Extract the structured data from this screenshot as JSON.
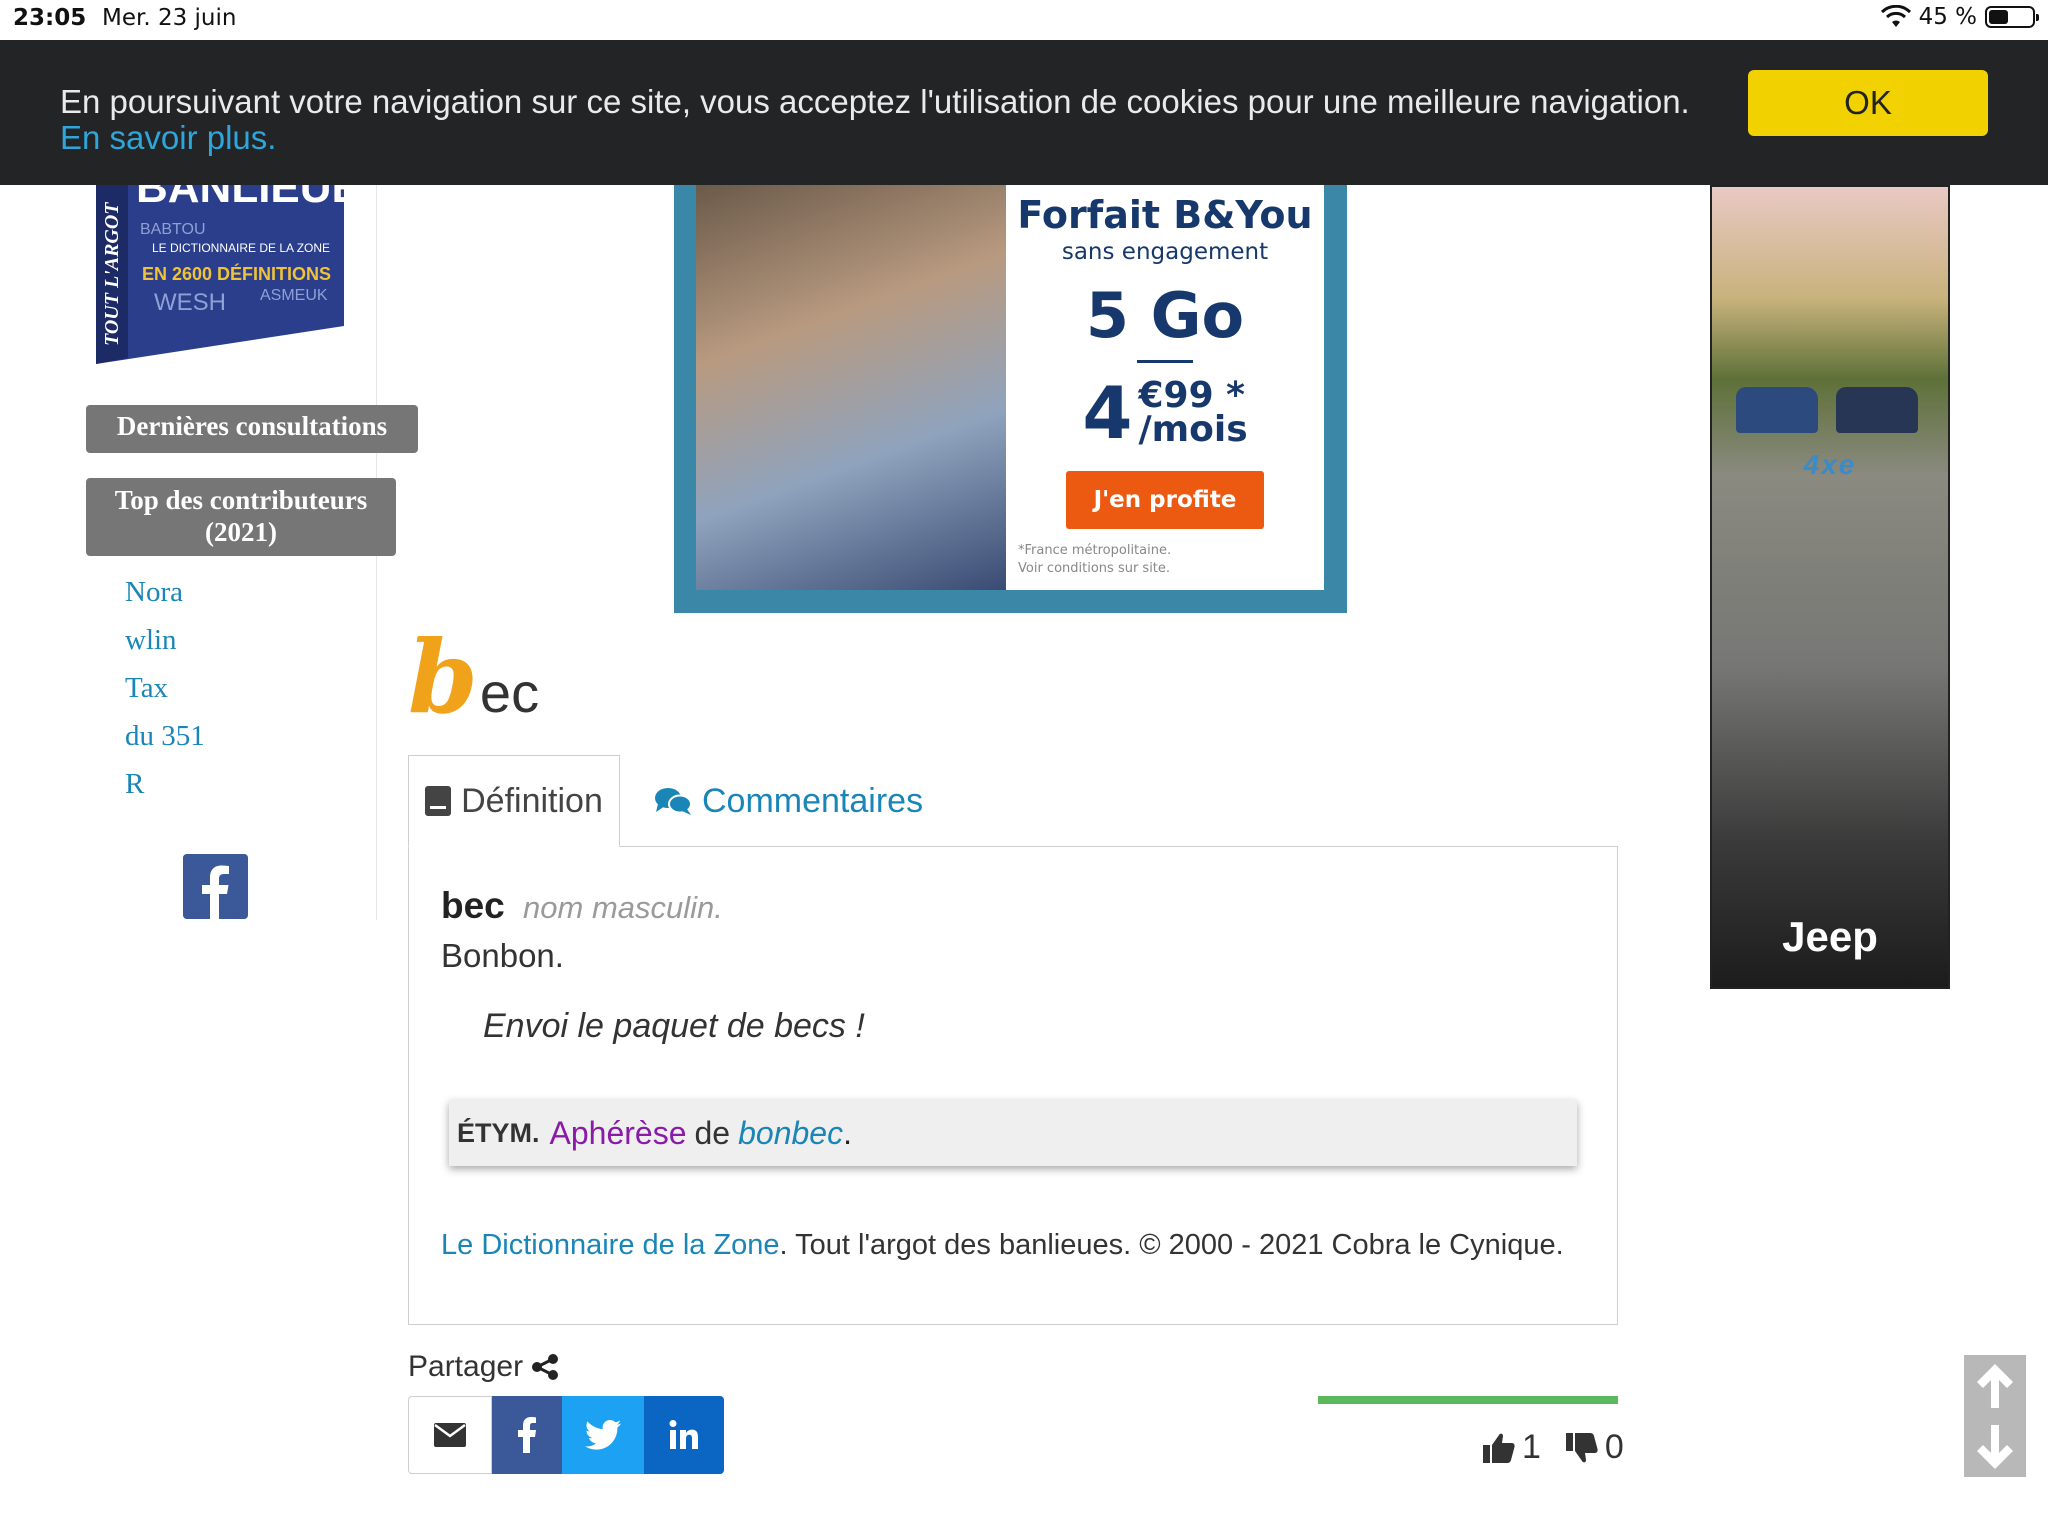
{
  "status_bar": {
    "time": "23:05",
    "date": "Mer. 23 juin",
    "battery": "45 %",
    "battery_level": 0.45
  },
  "cookie_banner": {
    "message": "En poursuivant votre navigation sur ce site, vous acceptez l'utilisation de cookies pour une meilleure navigation.",
    "more_link": "En savoir plus.",
    "ok_label": "OK",
    "ok_color": "#f1d100"
  },
  "sidebar": {
    "book_title": "BANLIEUES",
    "book_text_1": "LE DICTIONNAIRE DE LA ZONE",
    "book_text_2": "EN 2600 DÉFINITIONS",
    "book_words": [
      "BABTOU",
      "WESH",
      "ASMEUK"
    ],
    "book_spine": "TOUT L'ARGOT",
    "recent_label": "Dernières consultations",
    "top_label": "Top des contributeurs",
    "top_year": "(2021)",
    "contributors": [
      "Nora",
      "wlin",
      "Tax",
      "du 351",
      "R"
    ]
  },
  "ad_top": {
    "brand": "Forfait B&You",
    "subtitle": "sans engagement",
    "data": "5 Go",
    "price_int": "4",
    "price_dec": "€99",
    "price_star": "*",
    "price_unit": "/mois",
    "cta": "J'en profite",
    "legal_1": "*France métropolitaine.",
    "legal_2": "Voir conditions sur site."
  },
  "ad_side": {
    "model": "4xe",
    "brand": "Jeep"
  },
  "entry": {
    "first_letter": "b",
    "rest": "ec",
    "tabs": {
      "definition": "Définition",
      "comments": "Commentaires"
    },
    "term": "bec",
    "pos": "nom masculin.",
    "definition": "Bonbon.",
    "example": "Envoi le paquet de becs !",
    "etym_label": "ÉTYM.",
    "etym_link1": "Aphérèse",
    "etym_mid": "de",
    "etym_link2": "bonbec",
    "etym_end": ".",
    "credit_link": "Le Dictionnaire de la Zone",
    "credit_rest": ". Tout l'argot des banlieues. © 2000 - 2021 Cobra le Cynique."
  },
  "share": {
    "label": "Partager"
  },
  "votes": {
    "up": "1",
    "down": "0"
  },
  "colors": {
    "accent_orange": "#f0a21a",
    "link_blue": "#1a86b8",
    "facebook": "#3b5998",
    "twitter": "#1da1f2",
    "linkedin": "#0a66c2"
  }
}
